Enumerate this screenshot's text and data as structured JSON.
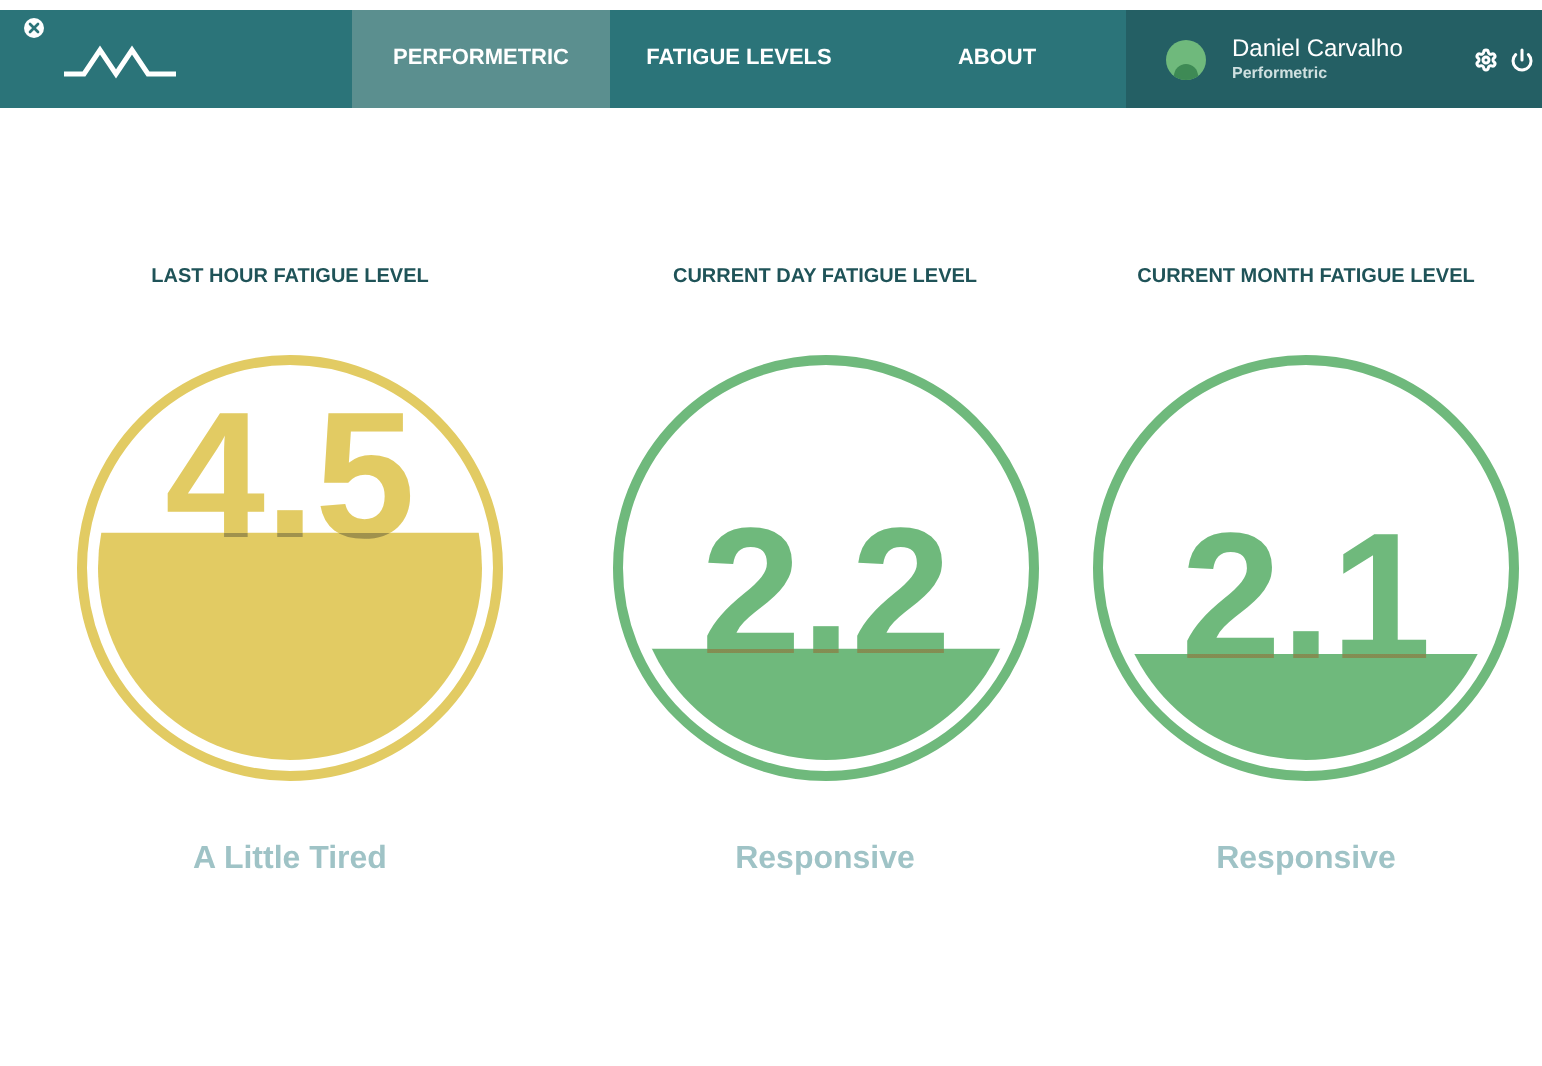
{
  "nav": {
    "tabs": [
      {
        "label": "PERFORMETRIC",
        "selected": true
      },
      {
        "label": "FATIGUE LEVELS",
        "selected": false
      },
      {
        "label": "ABOUT",
        "selected": false
      }
    ]
  },
  "user": {
    "name": "Daniel Carvalho",
    "subtitle": "Performetric"
  },
  "gauges": [
    {
      "title": "LAST HOUR FATIGUE LEVEL",
      "value": "4.5",
      "color": "#e2cb63",
      "status": "A Little Tired"
    },
    {
      "title": "CURRENT DAY FATIGUE LEVEL",
      "value": "2.2",
      "color": "#6fb97c",
      "status": "Responsive"
    },
    {
      "title": "CURRENT MONTH FATIGUE LEVEL",
      "value": "2.1",
      "color": "#6fb97c",
      "status": "Responsive"
    }
  ]
}
